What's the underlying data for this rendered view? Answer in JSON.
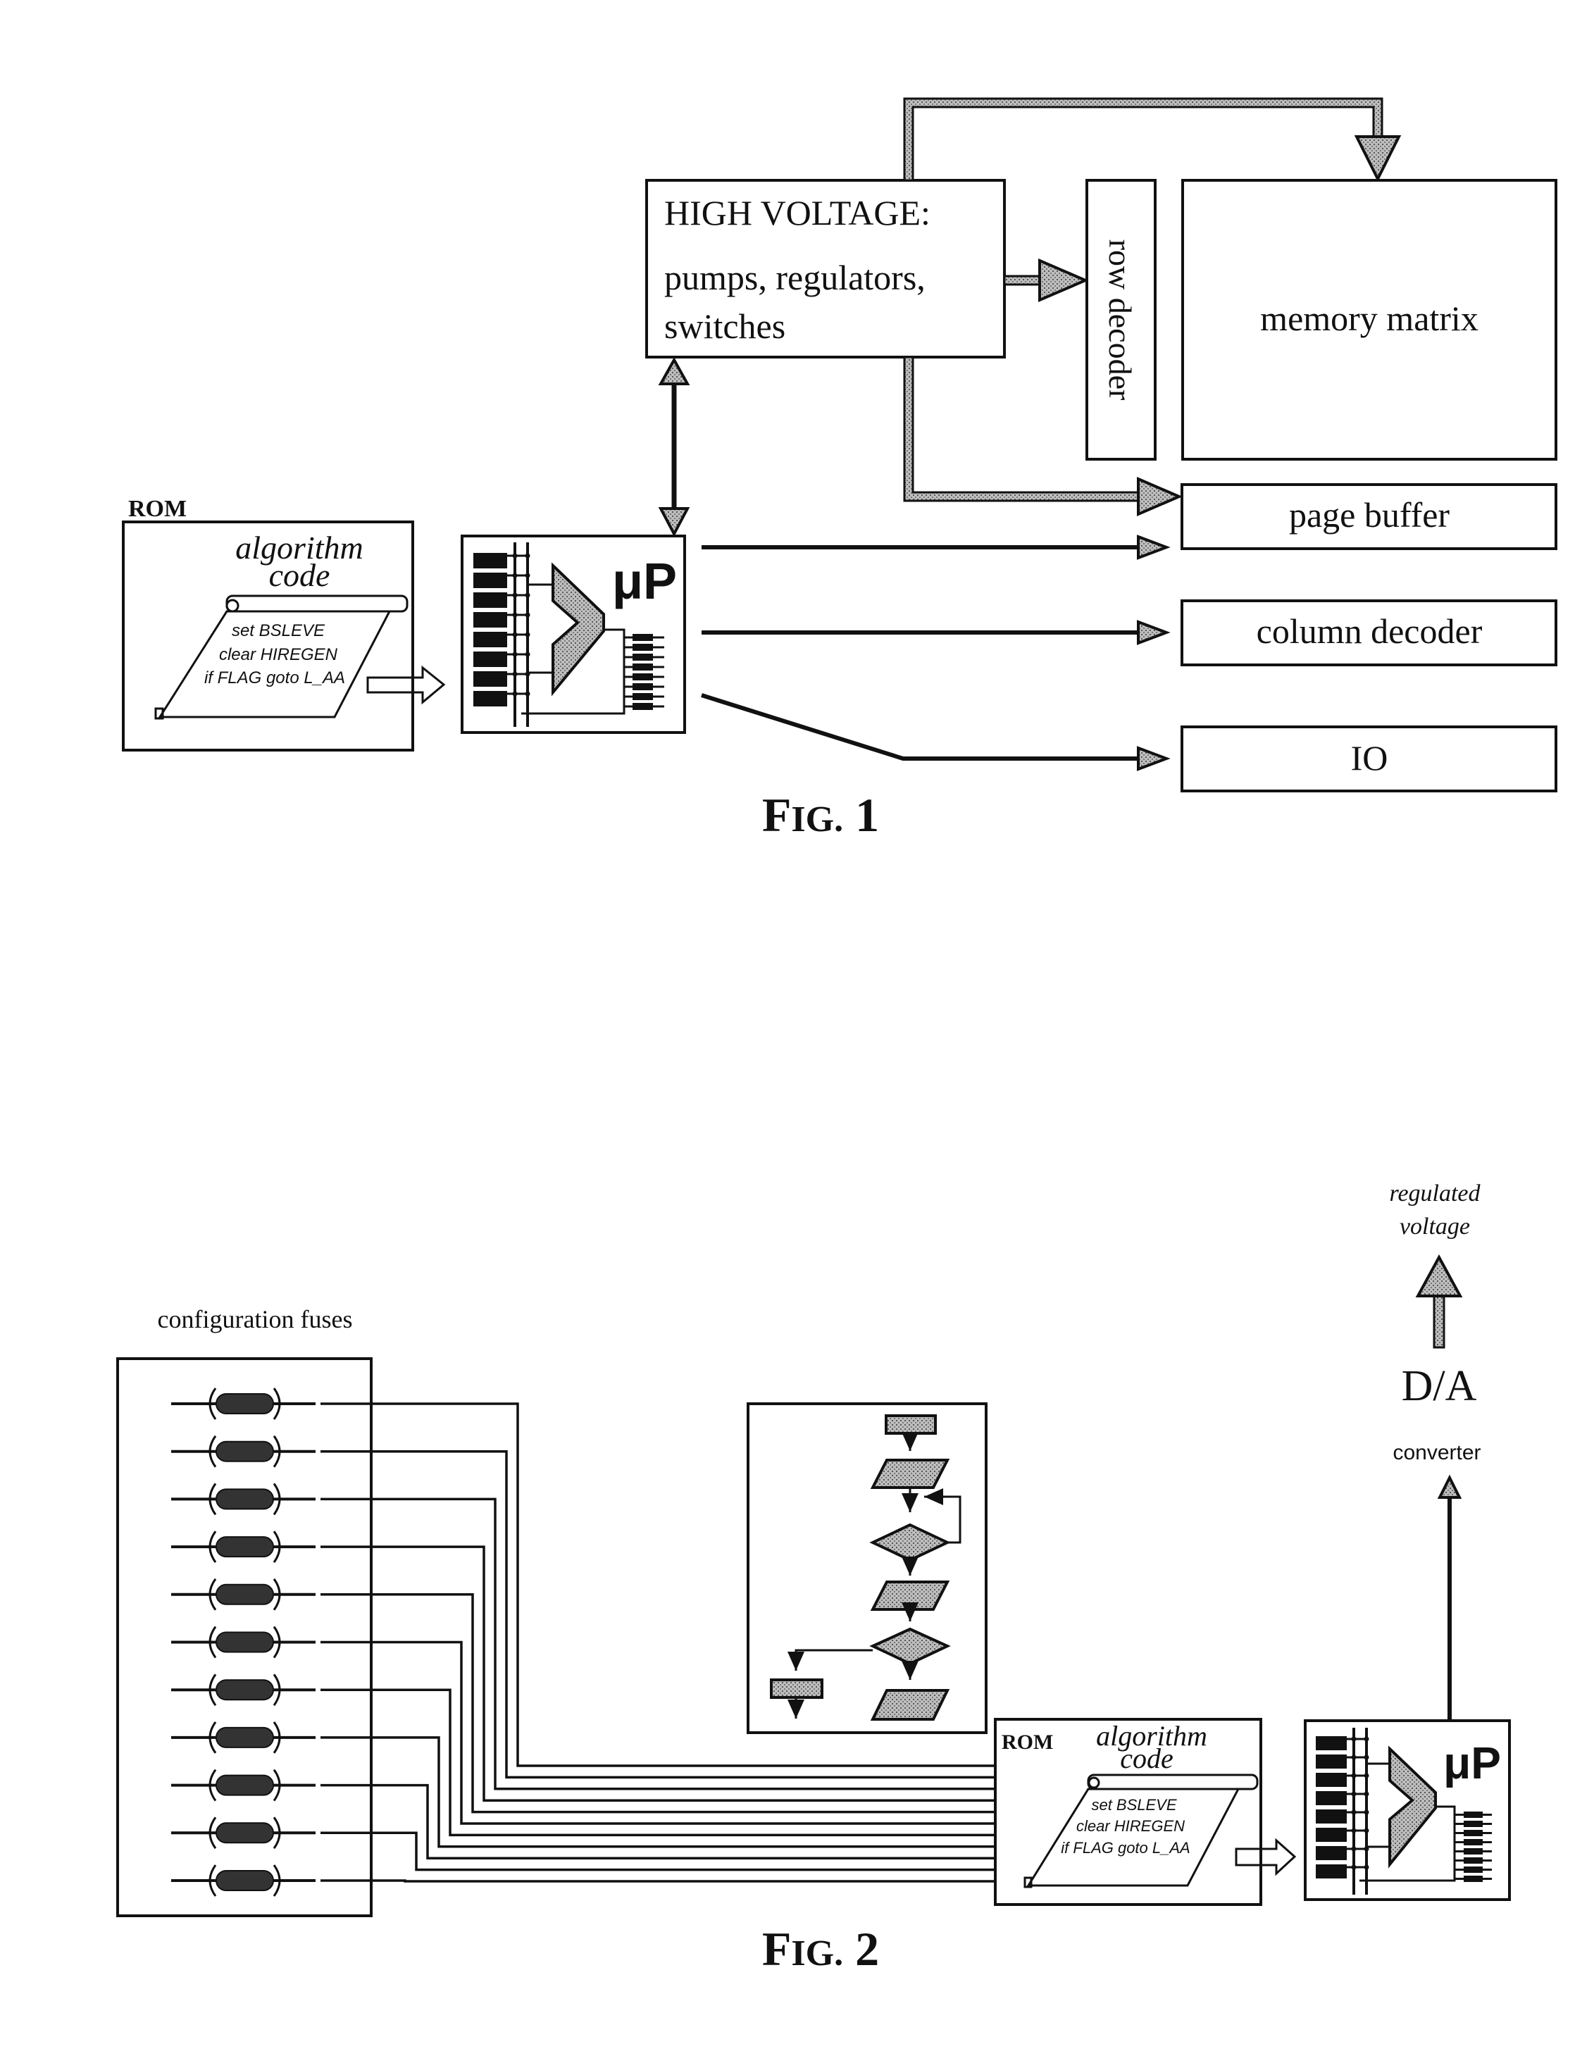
{
  "figures": [
    {
      "caption": "FIG. 1",
      "rom": {
        "label": "ROM",
        "title_line1": "algorithm",
        "title_line2": "code",
        "code_lines": [
          "set BSLEVE",
          "clear HIREGEN",
          "if FLAG goto L_AA"
        ]
      },
      "processor": {
        "label": "μP",
        "input_registers": 8,
        "output_registers": 8
      },
      "high_voltage": {
        "title": "HIGH VOLTAGE:",
        "line1": "pumps, regulators,",
        "line2": "switches"
      },
      "blocks": {
        "row_decoder": "row decoder",
        "memory_matrix": "memory matrix",
        "page_buffer": "page buffer",
        "column_decoder": "column decoder",
        "io": "IO"
      }
    },
    {
      "caption": "FIG. 2",
      "fuses": {
        "label": "configuration fuses",
        "count": 11
      },
      "flowchart": {
        "steps": [
          "terminal",
          "parallelogram",
          "diamond",
          "parallelogram",
          "diamond",
          "terminal",
          "parallelogram"
        ]
      },
      "rom": {
        "label": "ROM",
        "title_line1": "algorithm",
        "title_line2": "code",
        "code_lines": [
          "set BSLEVE",
          "clear HIREGEN",
          "if FLAG goto L_AA"
        ]
      },
      "processor": {
        "label": "μP",
        "input_registers": 8,
        "output_registers": 8
      },
      "converter": {
        "title": "D/A",
        "subtitle": "converter",
        "output_line1": "regulated",
        "output_line2": "voltage"
      }
    }
  ]
}
